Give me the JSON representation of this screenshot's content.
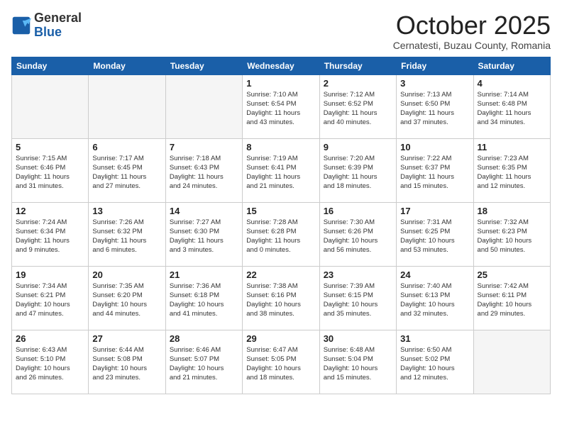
{
  "logo": {
    "general": "General",
    "blue": "Blue"
  },
  "header": {
    "month": "October 2025",
    "location": "Cernatesti, Buzau County, Romania"
  },
  "days_of_week": [
    "Sunday",
    "Monday",
    "Tuesday",
    "Wednesday",
    "Thursday",
    "Friday",
    "Saturday"
  ],
  "weeks": [
    [
      {
        "day": "",
        "detail": ""
      },
      {
        "day": "",
        "detail": ""
      },
      {
        "day": "",
        "detail": ""
      },
      {
        "day": "1",
        "detail": "Sunrise: 7:10 AM\nSunset: 6:54 PM\nDaylight: 11 hours\nand 43 minutes."
      },
      {
        "day": "2",
        "detail": "Sunrise: 7:12 AM\nSunset: 6:52 PM\nDaylight: 11 hours\nand 40 minutes."
      },
      {
        "day": "3",
        "detail": "Sunrise: 7:13 AM\nSunset: 6:50 PM\nDaylight: 11 hours\nand 37 minutes."
      },
      {
        "day": "4",
        "detail": "Sunrise: 7:14 AM\nSunset: 6:48 PM\nDaylight: 11 hours\nand 34 minutes."
      }
    ],
    [
      {
        "day": "5",
        "detail": "Sunrise: 7:15 AM\nSunset: 6:46 PM\nDaylight: 11 hours\nand 31 minutes."
      },
      {
        "day": "6",
        "detail": "Sunrise: 7:17 AM\nSunset: 6:45 PM\nDaylight: 11 hours\nand 27 minutes."
      },
      {
        "day": "7",
        "detail": "Sunrise: 7:18 AM\nSunset: 6:43 PM\nDaylight: 11 hours\nand 24 minutes."
      },
      {
        "day": "8",
        "detail": "Sunrise: 7:19 AM\nSunset: 6:41 PM\nDaylight: 11 hours\nand 21 minutes."
      },
      {
        "day": "9",
        "detail": "Sunrise: 7:20 AM\nSunset: 6:39 PM\nDaylight: 11 hours\nand 18 minutes."
      },
      {
        "day": "10",
        "detail": "Sunrise: 7:22 AM\nSunset: 6:37 PM\nDaylight: 11 hours\nand 15 minutes."
      },
      {
        "day": "11",
        "detail": "Sunrise: 7:23 AM\nSunset: 6:35 PM\nDaylight: 11 hours\nand 12 minutes."
      }
    ],
    [
      {
        "day": "12",
        "detail": "Sunrise: 7:24 AM\nSunset: 6:34 PM\nDaylight: 11 hours\nand 9 minutes."
      },
      {
        "day": "13",
        "detail": "Sunrise: 7:26 AM\nSunset: 6:32 PM\nDaylight: 11 hours\nand 6 minutes."
      },
      {
        "day": "14",
        "detail": "Sunrise: 7:27 AM\nSunset: 6:30 PM\nDaylight: 11 hours\nand 3 minutes."
      },
      {
        "day": "15",
        "detail": "Sunrise: 7:28 AM\nSunset: 6:28 PM\nDaylight: 11 hours\nand 0 minutes."
      },
      {
        "day": "16",
        "detail": "Sunrise: 7:30 AM\nSunset: 6:26 PM\nDaylight: 10 hours\nand 56 minutes."
      },
      {
        "day": "17",
        "detail": "Sunrise: 7:31 AM\nSunset: 6:25 PM\nDaylight: 10 hours\nand 53 minutes."
      },
      {
        "day": "18",
        "detail": "Sunrise: 7:32 AM\nSunset: 6:23 PM\nDaylight: 10 hours\nand 50 minutes."
      }
    ],
    [
      {
        "day": "19",
        "detail": "Sunrise: 7:34 AM\nSunset: 6:21 PM\nDaylight: 10 hours\nand 47 minutes."
      },
      {
        "day": "20",
        "detail": "Sunrise: 7:35 AM\nSunset: 6:20 PM\nDaylight: 10 hours\nand 44 minutes."
      },
      {
        "day": "21",
        "detail": "Sunrise: 7:36 AM\nSunset: 6:18 PM\nDaylight: 10 hours\nand 41 minutes."
      },
      {
        "day": "22",
        "detail": "Sunrise: 7:38 AM\nSunset: 6:16 PM\nDaylight: 10 hours\nand 38 minutes."
      },
      {
        "day": "23",
        "detail": "Sunrise: 7:39 AM\nSunset: 6:15 PM\nDaylight: 10 hours\nand 35 minutes."
      },
      {
        "day": "24",
        "detail": "Sunrise: 7:40 AM\nSunset: 6:13 PM\nDaylight: 10 hours\nand 32 minutes."
      },
      {
        "day": "25",
        "detail": "Sunrise: 7:42 AM\nSunset: 6:11 PM\nDaylight: 10 hours\nand 29 minutes."
      }
    ],
    [
      {
        "day": "26",
        "detail": "Sunrise: 6:43 AM\nSunset: 5:10 PM\nDaylight: 10 hours\nand 26 minutes."
      },
      {
        "day": "27",
        "detail": "Sunrise: 6:44 AM\nSunset: 5:08 PM\nDaylight: 10 hours\nand 23 minutes."
      },
      {
        "day": "28",
        "detail": "Sunrise: 6:46 AM\nSunset: 5:07 PM\nDaylight: 10 hours\nand 21 minutes."
      },
      {
        "day": "29",
        "detail": "Sunrise: 6:47 AM\nSunset: 5:05 PM\nDaylight: 10 hours\nand 18 minutes."
      },
      {
        "day": "30",
        "detail": "Sunrise: 6:48 AM\nSunset: 5:04 PM\nDaylight: 10 hours\nand 15 minutes."
      },
      {
        "day": "31",
        "detail": "Sunrise: 6:50 AM\nSunset: 5:02 PM\nDaylight: 10 hours\nand 12 minutes."
      },
      {
        "day": "",
        "detail": ""
      }
    ]
  ]
}
